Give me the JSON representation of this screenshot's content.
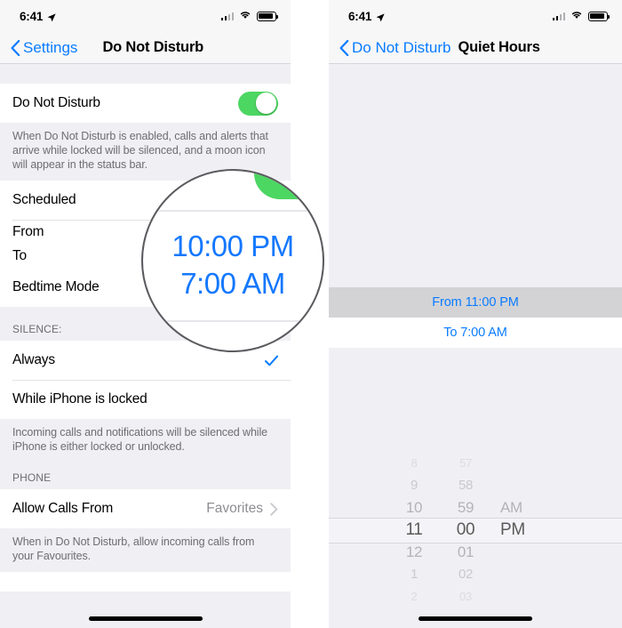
{
  "left_phone": {
    "status_bar": {
      "time": "6:41",
      "location_icon": "location-arrow-icon",
      "signal_icon": "cellular-signal-icon",
      "wifi_icon": "wifi-icon",
      "battery_icon": "battery-icon"
    },
    "nav": {
      "back_label": "Settings",
      "back_icon": "chevron-left-icon",
      "title": "Do Not Disturb"
    },
    "dnd_row": {
      "label": "Do Not Disturb",
      "toggle_state": "on",
      "toggle_color": "#4CD662"
    },
    "dnd_footnote": "When Do Not Disturb is enabled, calls and alerts that arrive while locked will be silenced, and a moon icon will appear in the status bar.",
    "scheduled_row": {
      "label": "Scheduled"
    },
    "from_label": "From",
    "to_label": "To",
    "bedtime_row": {
      "label": "Bedtime Mode"
    },
    "silence_header": "SILENCE:",
    "silence_options": [
      {
        "label": "Always",
        "checked": true,
        "check_icon": "checkmark-icon"
      },
      {
        "label": "While iPhone is locked",
        "checked": false
      }
    ],
    "silence_footnote": "Incoming calls and notifications will be silenced while iPhone is either locked or unlocked.",
    "phone_header": "PHONE",
    "allow_calls_row": {
      "label": "Allow Calls From",
      "value": "Favorites",
      "disclosure_icon": "chevron-right-icon"
    },
    "phone_footnote": "When in Do Not Disturb, allow incoming calls from your Favourites.",
    "home_indicator": "home-indicator"
  },
  "magnifier": {
    "time_from": "10:00 PM",
    "time_to": "7:00 AM",
    "text_color": "#1478FF",
    "accent_green": "#4CD662"
  },
  "right_phone": {
    "status_bar": {
      "time": "6:41",
      "location_icon": "location-arrow-icon",
      "signal_icon": "cellular-signal-icon",
      "wifi_icon": "wifi-icon",
      "battery_icon": "battery-icon"
    },
    "nav": {
      "back_label": "Do Not Disturb",
      "back_icon": "chevron-left-icon",
      "title": "Quiet Hours"
    },
    "from_cell": {
      "label": "From 11:00 PM",
      "selected": true
    },
    "to_cell": {
      "label": "To 7:00 AM",
      "selected": false
    },
    "time_picker": {
      "hours": [
        "8",
        "9",
        "10",
        "11",
        "12",
        "1",
        "2"
      ],
      "minutes": [
        "57",
        "58",
        "59",
        "00",
        "01",
        "02",
        "03"
      ],
      "meridiem": [
        "",
        "",
        "AM",
        "PM",
        "",
        "",
        ""
      ],
      "selected_hour": "11",
      "selected_minute": "00",
      "selected_meridiem": "PM"
    },
    "home_indicator": "home-indicator"
  }
}
